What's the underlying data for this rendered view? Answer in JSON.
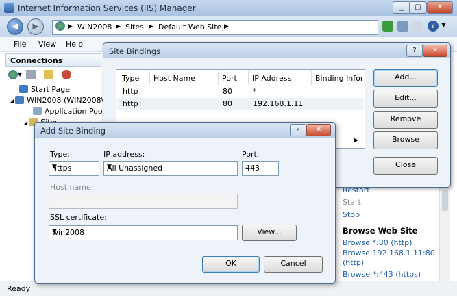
{
  "window": {
    "title": "Internet Information Services (IIS) Manager"
  },
  "address": {
    "segments": [
      "WIN2008",
      "Sites",
      "Default Web Site"
    ]
  },
  "menu": {
    "items": [
      "File",
      "View",
      "Help"
    ]
  },
  "connections": {
    "header": "Connections",
    "tree": [
      "Start Page",
      "WIN2008 (WIN2008\\A",
      "Application Pools",
      "Sites"
    ]
  },
  "site_bindings": {
    "title": "Site Bindings",
    "help": "?",
    "close": "✕",
    "columns": [
      "Type",
      "Host Name",
      "Port",
      "IP Address",
      "Binding Inforn"
    ],
    "rows": [
      {
        "type": "http",
        "host": "",
        "port": "80",
        "ip": "*"
      },
      {
        "type": "http",
        "host": "",
        "port": "80",
        "ip": "192.168.1.11"
      }
    ],
    "buttons": {
      "add": "Add...",
      "edit": "Edit...",
      "remove": "Remove",
      "browse": "Browse",
      "close": "Close"
    }
  },
  "add_binding": {
    "title": "Add Site Binding",
    "help": "?",
    "close": "✕",
    "type_label": "Type:",
    "type_value": "https",
    "ip_label": "IP address:",
    "ip_value": "All Unassigned",
    "port_label": "Port:",
    "port_value": "443",
    "host_label": "Host name:",
    "host_value": "",
    "ssl_label": "SSL certificate:",
    "ssl_value": "win2008",
    "view_button": "View...",
    "ok_button": "OK",
    "cancel_button": "Cancel"
  },
  "actions": {
    "restart": "Restart",
    "start": "Start",
    "stop": "Stop",
    "browse_header": "Browse Web Site",
    "browse_80": "Browse *:80 (http)",
    "browse_ip_line1": "Browse 192.168.1.11:80",
    "browse_ip_line2": "(http)",
    "browse_443": "Browse *:443 (https)"
  },
  "status": {
    "text": "Ready"
  }
}
